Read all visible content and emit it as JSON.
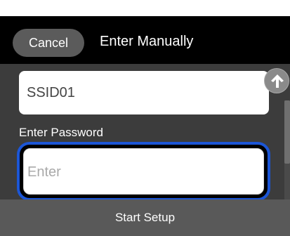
{
  "header": {
    "cancel_label": "Cancel",
    "title": "Enter Manually"
  },
  "form": {
    "ssid_value": "SSID01",
    "password_label": "Enter Password",
    "password_placeholder": "Enter"
  },
  "footer": {
    "start_label": "Start Setup"
  },
  "icons": {
    "scroll_up": "arrow-up-icon"
  },
  "colors": {
    "header_bg": "#000000",
    "content_bg": "#3c3c3c",
    "cancel_bg": "#5b5b5b",
    "focus_ring": "#1c56d6",
    "footer_bg": "#595959"
  }
}
